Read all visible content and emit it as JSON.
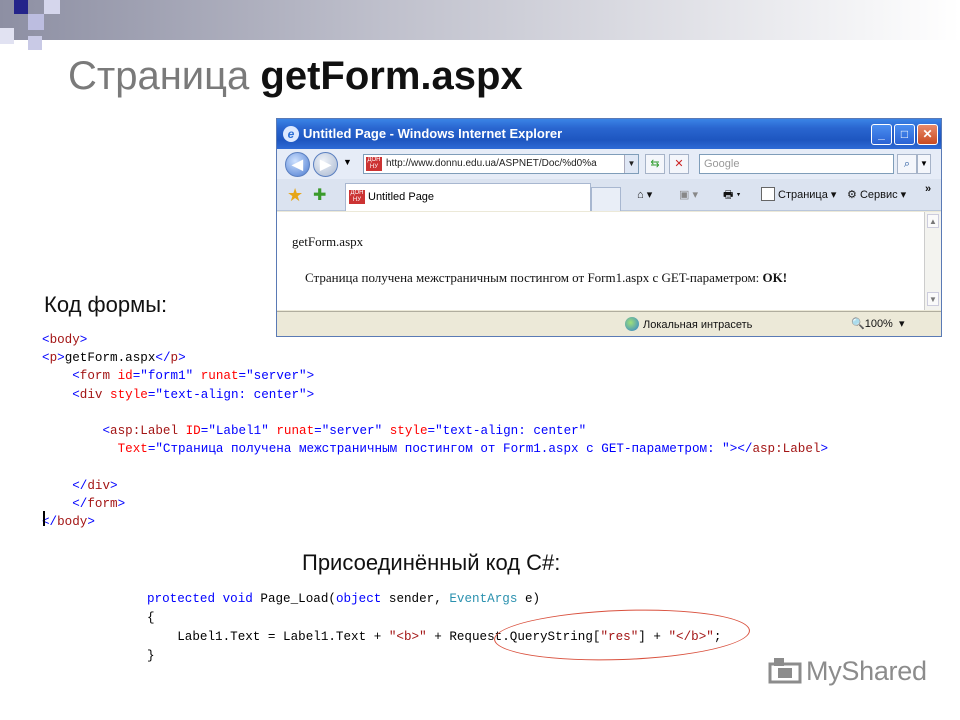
{
  "slide": {
    "title_prefix": "Страница ",
    "title_bold": "getForm.aspx",
    "form_code_label": "Код формы:",
    "csharp_label": "Присоединённый код C#:",
    "watermark": "MyShared"
  },
  "browser": {
    "window_title": "Untitled Page - Windows Internet Explorer",
    "address": "http://www.donnu.edu.ua/ASPNET/Doc/%d0%a",
    "search_placeholder": "Google",
    "tab_title": "Untitled Page",
    "tools": {
      "page_menu": "Страница",
      "service_menu": "Сервис",
      "overflow": "»"
    },
    "content": {
      "heading": "getForm.aspx",
      "message": "Страница получена межстраничным постингом от Form1.aspx с GET-параметром: ",
      "message_bold": "OK!"
    },
    "status": {
      "zone": "Локальная интрасеть",
      "zoom": "100%"
    }
  },
  "html_code": [
    "<body>",
    "<p>getForm.aspx</p>",
    "    <form id=\"form1\" runat=\"server\">",
    "    <div style=\"text-align: center\">",
    "",
    "        <asp:Label ID=\"Label1\" runat=\"server\" style=\"text-align: center\"",
    "          Text=\"Страница получена межстраничным постингом от Form1.aspx с GET-параметром: \"></asp:Label>",
    "",
    "    </div>",
    "    </form>",
    "</body>"
  ],
  "csharp_code": [
    "protected void Page_Load(object sender, EventArgs e)",
    "{",
    "    Label1.Text = Label1.Text + \"<b>\" + Request.QueryString[\"res\"] + \"</b>\";",
    "}"
  ],
  "icon_names": [
    "ie-logo-icon",
    "back-icon",
    "forward-icon",
    "refresh-icon",
    "stop-icon",
    "search-icon",
    "favorites-star-icon",
    "add-favorites-icon",
    "home-icon",
    "feeds-icon",
    "print-icon",
    "page-icon",
    "tools-gear-icon",
    "globe-icon",
    "zoom-icon",
    "myshared-logo-icon"
  ]
}
